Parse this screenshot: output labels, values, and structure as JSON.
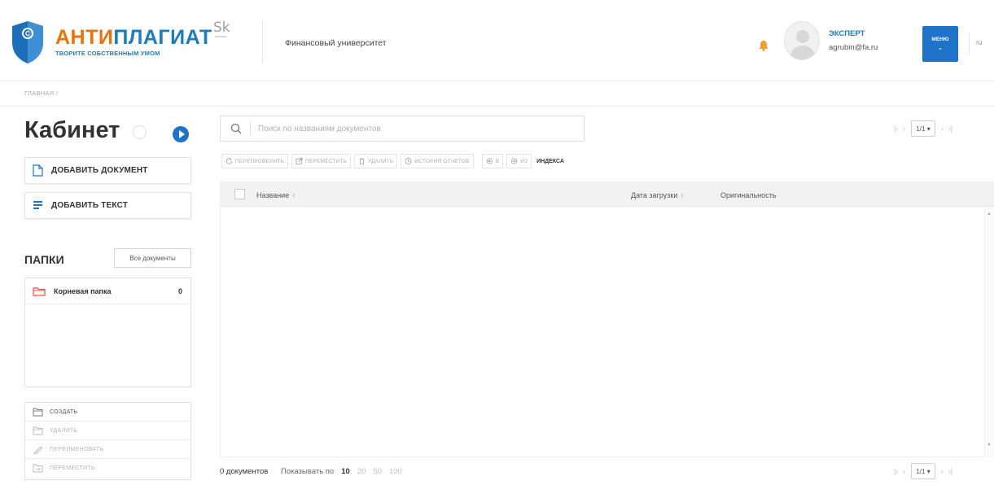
{
  "header": {
    "logo_part1": "АНТИ",
    "logo_part2": "ПЛАГИАТ",
    "logo_tagline": "ТВОРИТЕ СОБСТВЕННЫМ УМОМ",
    "partner": "Sk",
    "organization": "Финансовый университет",
    "user_role": "ЭКСПЕРТ",
    "user_email": "agrubin@fa.ru",
    "menu_label": "МЕНЮ",
    "menu_chevron": "⌄",
    "language": "ru"
  },
  "breadcrumb": "ГЛАВНАЯ /",
  "sidebar": {
    "title": "Кабинет",
    "add_document": "ДОБАВИТЬ ДОКУМЕНТ",
    "add_text": "ДОБАВИТЬ ТЕКСТ",
    "folders_title": "ПАПКИ",
    "all_documents": "Все документы",
    "folders": [
      {
        "name": "Корневая папка",
        "count": "0"
      }
    ],
    "folder_actions": [
      {
        "label": "СОЗДАТЬ",
        "enabled": true
      },
      {
        "label": "УДАЛИТЬ",
        "enabled": false
      },
      {
        "label": "ПЕРЕИМЕНОВАТЬ",
        "enabled": false
      },
      {
        "label": "ПЕРЕМЕСТИТЬ",
        "enabled": false
      }
    ]
  },
  "search": {
    "placeholder": "Поиск по названиям документов"
  },
  "pagination_top": {
    "page": "1/1"
  },
  "pagination_bottom": {
    "page": "1/1"
  },
  "toolbar": {
    "recheck": "ПЕРЕПРОВЕРИТЬ",
    "move": "ПЕРЕМЕСТИТЬ",
    "delete": "УДАЛИТЬ",
    "report_history": "ИСТОРИЯ ОТЧЕТОВ",
    "to_index": "В",
    "from_index": "ИЗ",
    "index_label": "ИНДЕКСА"
  },
  "table": {
    "col_name": "Название",
    "col_date": "Дата загрузки",
    "col_originality": "Оригинальность"
  },
  "footer": {
    "doc_count": "0 документов",
    "show_by": "Показывать по",
    "page_sizes": [
      "10",
      "20",
      "50",
      "100"
    ],
    "active_page_size": "10"
  },
  "colors": {
    "accent_blue": "#1e73c9",
    "logo_orange": "#e8720c",
    "bell": "#f0a030"
  }
}
